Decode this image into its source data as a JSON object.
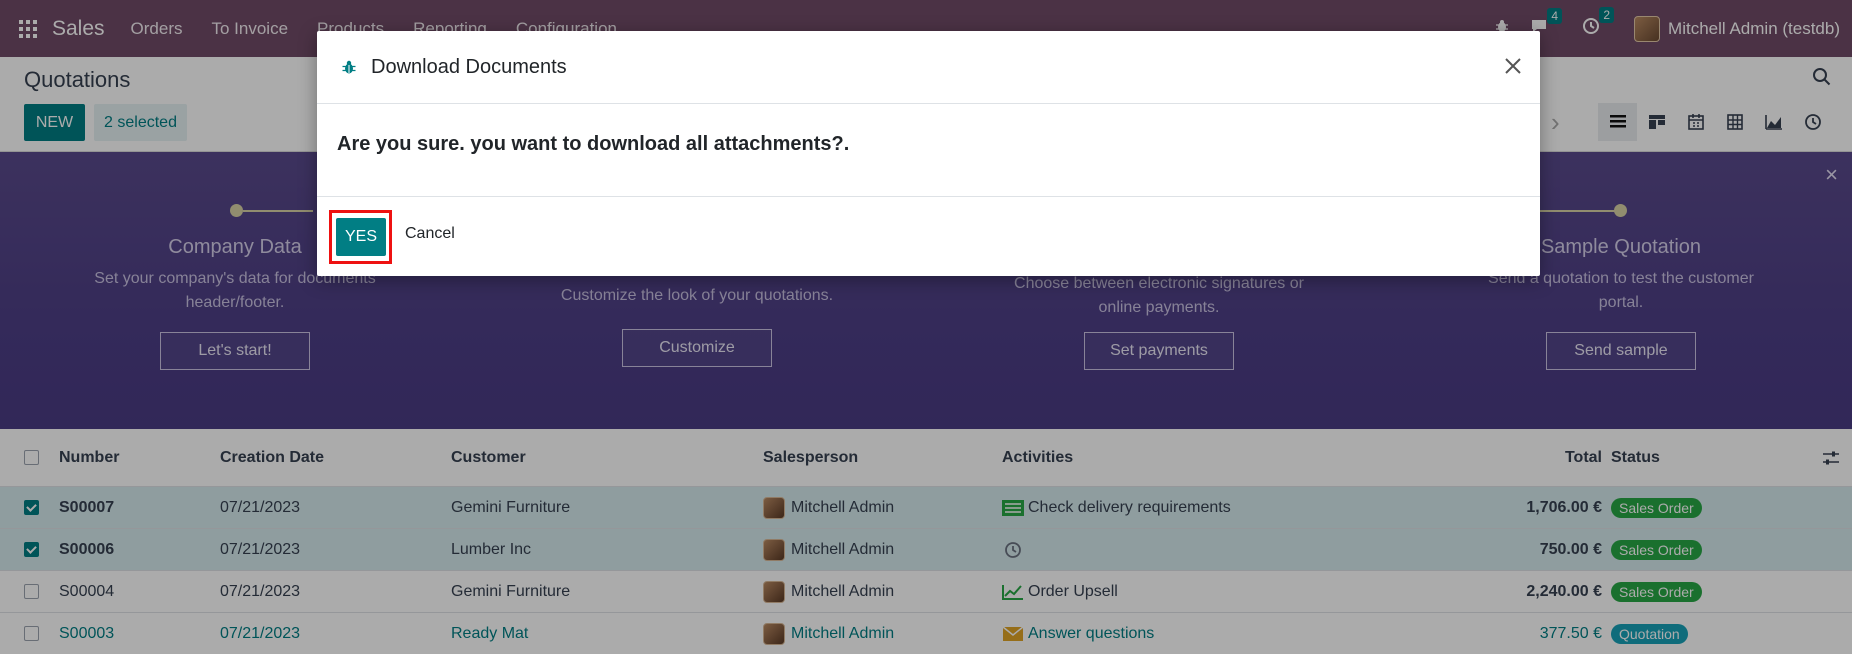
{
  "navbar": {
    "app_name": "Sales",
    "menu": [
      "Orders",
      "To Invoice",
      "Products",
      "Reporting",
      "Configuration"
    ],
    "messages_count": "4",
    "activities_count": "2",
    "user": "Mitchell Admin (testdb)"
  },
  "control": {
    "title": "Quotations",
    "new_label": "NEW",
    "selected_label": "2 selected"
  },
  "banner": {
    "steps": [
      {
        "title": "Company Data",
        "desc": "Set your company's data for documents header/footer.",
        "button": "Let's start!"
      },
      {
        "title": "",
        "desc": "Customize the look of your quotations.",
        "button": "Customize"
      },
      {
        "title": "",
        "desc": "Choose between electronic signatures or online payments.",
        "button": "Set payments"
      },
      {
        "title": "Sample Quotation",
        "desc": "Send a quotation to test the customer portal.",
        "button": "Send sample"
      }
    ]
  },
  "table": {
    "headers": {
      "number": "Number",
      "date": "Creation Date",
      "customer": "Customer",
      "salesperson": "Salesperson",
      "activities": "Activities",
      "total": "Total",
      "status": "Status"
    },
    "rows": [
      {
        "number": "S00007",
        "date": "07/21/2023",
        "customer": "Gemini Furniture",
        "salesperson": "Mitchell Admin",
        "activity": "Check delivery requirements",
        "activity_icon": "checklist-icon",
        "total": "1,706.00 €",
        "status": "Sales Order",
        "selected": true
      },
      {
        "number": "S00006",
        "date": "07/21/2023",
        "customer": "Lumber Inc",
        "salesperson": "Mitchell Admin",
        "activity": "",
        "activity_icon": "clock-icon",
        "total": "750.00 €",
        "status": "Sales Order",
        "selected": true
      },
      {
        "number": "S00004",
        "date": "07/21/2023",
        "customer": "Gemini Furniture",
        "salesperson": "Mitchell Admin",
        "activity": "Order Upsell",
        "activity_icon": "chart-line-icon",
        "total": "2,240.00 €",
        "status": "Sales Order",
        "selected": false
      },
      {
        "number": "S00003",
        "date": "07/21/2023",
        "customer": "Ready Mat",
        "salesperson": "Mitchell Admin",
        "activity": "Answer questions",
        "activity_icon": "envelope-icon",
        "total": "377.50 €",
        "status": "Quotation",
        "selected": false
      }
    ]
  },
  "modal": {
    "title": "Download Documents",
    "message": "Are you sure. you want to download all attachments?.",
    "yes_label": "YES",
    "cancel_label": "Cancel"
  },
  "colors": {
    "brand": "#714b67",
    "primary": "#017e84",
    "highlight": "#ee1111"
  }
}
